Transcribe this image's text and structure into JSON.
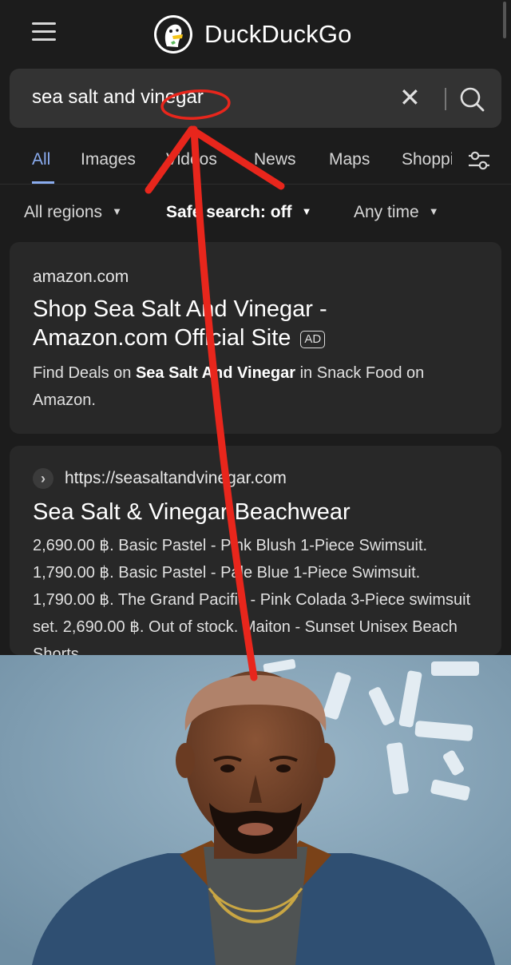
{
  "header": {
    "app_name": "DuckDuckGo"
  },
  "search": {
    "query": "sea salt and vinegar",
    "clear_symbol": "✕"
  },
  "tabs": [
    {
      "label": "All",
      "active": true
    },
    {
      "label": "Images"
    },
    {
      "label": "Videos"
    },
    {
      "label": "News"
    },
    {
      "label": "Maps"
    },
    {
      "label": "Shopping"
    }
  ],
  "filters": {
    "region": "All regions",
    "safe_search": "Safe search: off",
    "time": "Any time",
    "caret": "▼"
  },
  "results": [
    {
      "domain": "amazon.com",
      "title_line1": "Shop Sea Salt And Vinegar -",
      "title_line2": "Amazon.com Official Site",
      "ad_label": "AD",
      "snippet_pre": "Find Deals on ",
      "snippet_bold": "Sea Salt And Vinegar",
      "snippet_post": " in Snack Food on Amazon."
    },
    {
      "url": "https://seasaltandvinegar.com",
      "title": "Sea Salt & Vinegar Beachwear",
      "snippet": "2,690.00 ฿. Basic Pastel - Pink Blush 1-Piece Swimsuit. 1,790.00 ฿. Basic Pastel - Pale Blue 1-Piece Swimsuit. 1,790.00 ฿. The Grand Pacific - Pink Colada 3-Piece swimsuit set. 2,690.00 ฿. Out of stock. Maiton - Sunset Unisex Beach Shorts"
    }
  ],
  "colors": {
    "background": "#1c1c1c",
    "card": "#282828",
    "accent_blue": "#8aacef",
    "annotation_red": "#e8261c"
  },
  "icons": [
    "hamburger-menu-icon",
    "duckduckgo-logo-icon",
    "close-icon",
    "search-icon",
    "settings-sliders-icon",
    "chevron-right-icon"
  ]
}
